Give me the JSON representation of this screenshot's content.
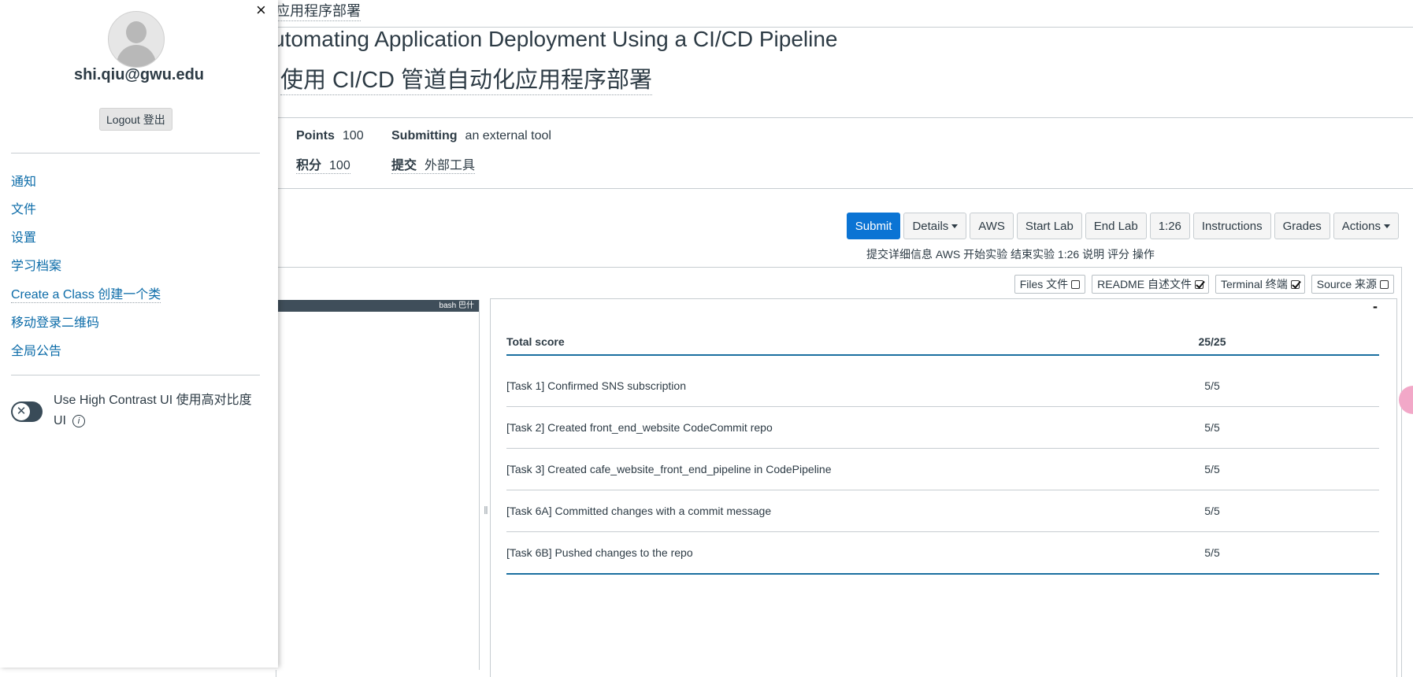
{
  "breadcrumb": "应用程序部署",
  "page": {
    "title_en": "utomating Application Deployment Using a CI/CD Pipeline",
    "title_zh": "使用 CI/CD 管道自动化应用程序部署"
  },
  "meta": {
    "points_label": "Points",
    "points_value": "100",
    "submitting_label": "Submitting",
    "submitting_value": "an external tool",
    "points_label_zh": "积分",
    "points_value_zh": "100",
    "submitting_label_zh": "提交",
    "submitting_value_zh": "外部工具"
  },
  "toolbar": {
    "submit": "Submit",
    "details": "Details",
    "aws": "AWS",
    "start_lab": "Start Lab",
    "end_lab": "End Lab",
    "timer": "1:26",
    "instructions": "Instructions",
    "grades": "Grades",
    "actions": "Actions",
    "translation": "提交详细信息 AWS 开始实验 结束实验 1:26 说明 评分 操作"
  },
  "panels": {
    "files": "Files  文件",
    "readme": "README  自述文件",
    "terminal": "Terminal  终端",
    "source": "Source  来源",
    "files_checked": false,
    "readme_checked": true,
    "terminal_checked": true,
    "source_checked": false
  },
  "terminal": {
    "label": "bash   巴什"
  },
  "grades_table": {
    "header_name": "Total score",
    "header_score": "25/25",
    "rows": [
      {
        "name": "[Task 1] Confirmed SNS subscription",
        "score": "5/5"
      },
      {
        "name": "[Task 2] Created front_end_website CodeCommit repo",
        "score": "5/5"
      },
      {
        "name": "[Task 3] Created cafe_website_front_end_pipeline in CodePipeline",
        "score": "5/5"
      },
      {
        "name": "[Task 6A] Committed changes with a commit message",
        "score": "5/5"
      },
      {
        "name": "[Task 6B] Pushed changes to the repo",
        "score": "5/5"
      }
    ],
    "collapse": "-"
  },
  "drawer": {
    "close": "×",
    "email": "shi.qiu@gwu.edu",
    "logout": "Logout 登出",
    "links": [
      "通知",
      "文件",
      "设置",
      "学习档案",
      "Create a Class 创建一个类",
      "移动登录二维码",
      "全局公告"
    ],
    "high_contrast_label": "Use High Contrast UI 使用高对比度 UI",
    "high_contrast_on": false
  },
  "colors": {
    "primary": "#0b74d4",
    "link": "#0b6ba8",
    "accent": "#1a6fa0"
  }
}
